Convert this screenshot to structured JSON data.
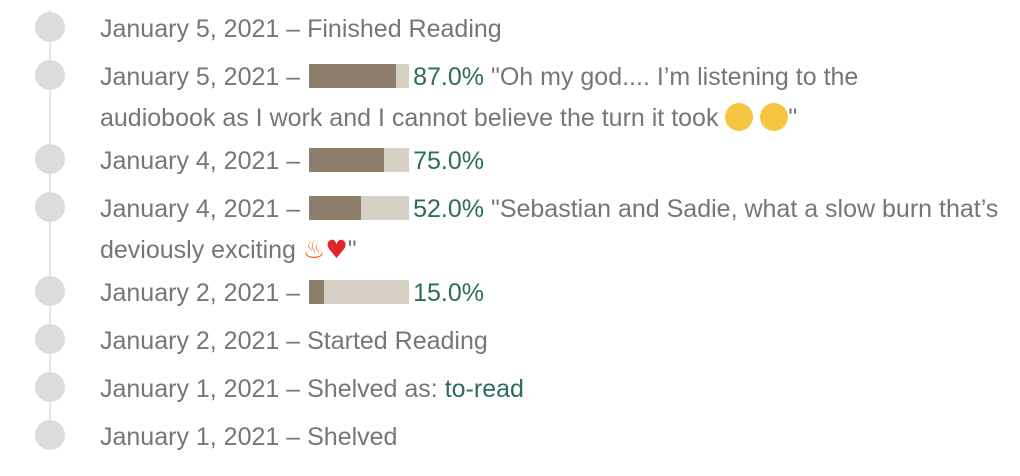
{
  "colors": {
    "text": "#767676",
    "link": "#2d6b5f",
    "progress_fill": "#8c7e6a",
    "progress_track": "#d6d0c4",
    "timeline_dot": "#dcdcdc"
  },
  "entries": [
    {
      "date": "January 5, 2021",
      "sep": "–",
      "text": "Finished Reading"
    },
    {
      "date": "January 5, 2021",
      "sep": "–",
      "progress": 0.87,
      "percent": "87.0%",
      "quote": "\"Oh my god.... I’m listening to the audiobook as I work and I cannot believe the turn it took",
      "emojis": [
        "astonished-face",
        "pleading-face"
      ],
      "quote_end": "\""
    },
    {
      "date": "January 4, 2021",
      "sep": "–",
      "progress": 0.75,
      "percent": "75.0%"
    },
    {
      "date": "January 4, 2021",
      "sep": "–",
      "progress": 0.52,
      "percent": "52.0%",
      "quote": "\"Sebastian and Sadie, what a slow burn that’s deviously exciting",
      "emojis": [
        "fire",
        "red-heart"
      ],
      "quote_end": "\""
    },
    {
      "date": "January 2, 2021",
      "sep": "–",
      "progress": 0.15,
      "percent": "15.0%"
    },
    {
      "date": "January 2, 2021",
      "sep": "–",
      "text": "Started Reading"
    },
    {
      "date": "January 1, 2021",
      "sep": "–",
      "text": "Shelved as:",
      "link": "to-read"
    },
    {
      "date": "January 1, 2021",
      "sep": "–",
      "text": "Shelved"
    }
  ],
  "emoji_glyphs": {
    "astonished": "😮",
    "pleading": "🥺",
    "fire": "🔥",
    "heart": "❤️"
  }
}
